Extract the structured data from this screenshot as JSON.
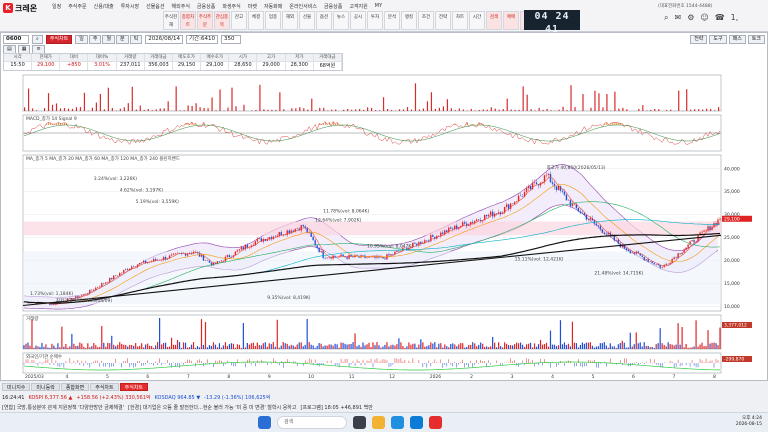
{
  "app": {
    "logo_glyph": "K",
    "brand": "크레온",
    "menu": [
      "일정",
      "주식주문",
      "신용/대출",
      "투자시장",
      "선물옵션",
      "해외주식",
      "금융상품",
      "파생주식",
      "마켓",
      "자동화매",
      "온라인서비스",
      "금융상품",
      "고객지원",
      "MY"
    ],
    "toolbar": [
      {
        "label": "주식현재",
        "hl": false
      },
      {
        "label": "종합차트",
        "hl": true
      },
      {
        "label": "주식주문",
        "hl": true
      },
      {
        "label": "관심종목",
        "hl": true
      },
      {
        "label": "잔고",
        "hl": false
      },
      {
        "label": "체결",
        "hl": false
      },
      {
        "label": "업종",
        "hl": false
      },
      {
        "label": "해외",
        "hl": false
      },
      {
        "label": "선물",
        "hl": false
      },
      {
        "label": "옵션",
        "hl": false
      },
      {
        "label": "뉴스",
        "hl": false
      },
      {
        "label": "공시",
        "hl": false
      },
      {
        "label": "투자",
        "hl": false
      },
      {
        "label": "분석",
        "hl": false
      },
      {
        "label": "랭킹",
        "hl": false
      },
      {
        "label": "조건",
        "hl": false
      },
      {
        "label": "전략",
        "hl": false
      },
      {
        "label": "차트",
        "hl": false
      },
      {
        "label": "시간",
        "hl": false
      },
      {
        "label": "검색",
        "hl": true
      },
      {
        "label": "매매",
        "hl": true
      },
      {
        "label": "자동",
        "hl": true
      },
      {
        "label": "설정",
        "hl": false
      },
      {
        "label": "증권",
        "hl": false
      }
    ],
    "clock": "04 24 41",
    "clock_date": "2026-08-15 토",
    "hotline": "(대표전화번호 1544-4488)",
    "icons": [
      "⌕",
      "✉",
      "⚙",
      "☺",
      "☎",
      "1,"
    ]
  },
  "form": {
    "code": "0600",
    "tab_label": "주식차트",
    "interval_btns": [
      "일",
      "주",
      "월",
      "분",
      "틱"
    ],
    "date": "2026/08/14",
    "period": "기간:6410",
    "count": "350",
    "right_btns": [
      "전략",
      "도구",
      "패스",
      "토크"
    ]
  },
  "quote": {
    "headers": [
      "시각",
      "현재가",
      "대비",
      "대비%",
      "거래량",
      "거래대금",
      "매도호가",
      "매수호가",
      "시가",
      "고가",
      "저가",
      "거래대금"
    ],
    "values": [
      "15:50",
      "29,100",
      "+850",
      "3.01%",
      "237,011",
      "356,003",
      "29,150",
      "29,100",
      "28,650",
      "29,000",
      "28,300",
      "68억원"
    ]
  },
  "chart_data": {
    "type": "line",
    "panels": [
      "주식지표",
      "MACD",
      "가격",
      "거래량",
      "투자자 순매수"
    ],
    "panel_labels": {
      "macd": "MACD_종가 14  Signal 9",
      "price": "MA_종가 5  MA_종가 20  MA_종가 60  MA_종가 120  MA_종가 240  볼린저밴드",
      "volume": "거래량",
      "investor": "외국인/기관 순매수"
    },
    "x_labels": [
      "2025/03",
      "4",
      "5",
      "6",
      "7",
      "8",
      "9",
      "10",
      "11",
      "12",
      "2026",
      "2",
      "3",
      "4",
      "5",
      "6",
      "7",
      "8"
    ],
    "price_y_ticks": [
      10000,
      15000,
      20000,
      25000,
      30000,
      35000,
      40000
    ],
    "ylim": [
      9000,
      43000
    ],
    "last_price": 29100,
    "annotations": [
      {
        "text": "1.73%(vol: 1,184K)",
        "x": 3,
        "y": 12500
      },
      {
        "text": "3.24%(vol: 3,226K)",
        "x": 35,
        "y": 37500
      },
      {
        "text": "4.62%(vol: 3,197K)",
        "x": 48,
        "y": 35000
      },
      {
        "text": "5.19%(vol: 3,559K)",
        "x": 56,
        "y": 32500
      },
      {
        "text": "11.78%(vol: 8,064K)",
        "x": 150,
        "y": 30500
      },
      {
        "text": "12.64%(vol: 7,902K)",
        "x": 146,
        "y": 28500
      },
      {
        "text": "10.95%(vol: 8,047K)",
        "x": 172,
        "y": 22800
      },
      {
        "text": "15.11%(vol: 12,421K)",
        "x": 246,
        "y": 20000
      },
      {
        "text": "9.35%(vol: 8,419K)",
        "x": 122,
        "y": 11600
      },
      {
        "text": "21.48%(vol: 14,715K)",
        "x": 286,
        "y": 17000
      },
      {
        "text": "최고가 40,850(2026/05/13)",
        "x": 262,
        "y": 40000
      },
      {
        "text": "최저가 9,150(2025/04/09)",
        "x": 16,
        "y": 11000
      }
    ],
    "right_axis_labels": [
      "29,100",
      "3,377,012",
      "-299,870"
    ]
  },
  "bottom": {
    "tabs": [
      {
        "label": "미니지수",
        "on": false
      },
      {
        "label": "미니등락",
        "on": false
      },
      {
        "label": "종합화면",
        "on": false
      },
      {
        "label": "주식차트",
        "on": false
      },
      {
        "label": "주식차트",
        "on": true
      }
    ],
    "ticker": [
      {
        "text": "16:24:41",
        "cls": ""
      },
      {
        "text": "KOSPI 6,377.56 ▲",
        "cls": "up"
      },
      {
        "text": "+158.56 (+2.43%) 330,561억",
        "cls": "up"
      },
      {
        "text": "KOSDAQ 964.85 ▼",
        "cls": "dn"
      },
      {
        "text": "-13.29 (-1.36%) 106,625억",
        "cls": "dn"
      }
    ],
    "news": [
      "[연합] 국방,통상분야 관계 지원정책 '다양한방안 금제해결'",
      "[한경] 대기업은 으뜸 줄 발전한다...현순 불러 가능 '미 중 미 변경' 철학시 응하고",
      "[프로그램] 18:05 +46,891 백만"
    ]
  },
  "taskbar": {
    "search": "검색",
    "time": "오후 4:24",
    "date": "2026-08-15"
  }
}
